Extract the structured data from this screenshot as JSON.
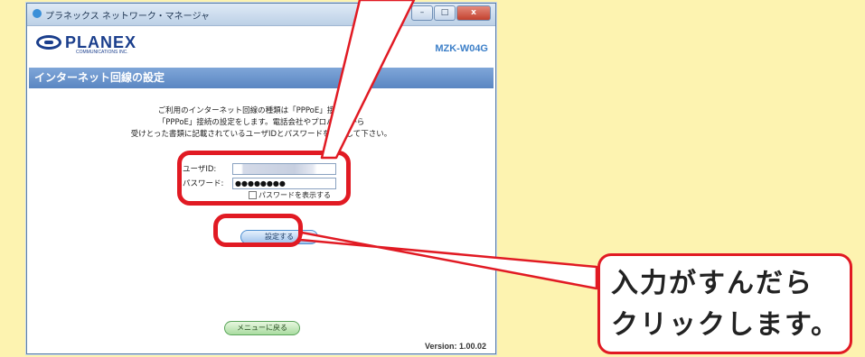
{
  "window": {
    "title": "プラネックス ネットワーク・マネージャ",
    "minimize_glyph": "–",
    "maximize_glyph": "□",
    "close_glyph": "x"
  },
  "brand": {
    "name": "PLANEX",
    "subtitle": "COMMUNICATIONS INC.",
    "model": "MZK-W04G"
  },
  "section": {
    "title": "インターネット回線の設定"
  },
  "intro": {
    "line1": "ご利用のインターネット回線の種類は「PPPoE」接続です。",
    "line2": "「PPPoE」接続の設定をします。電話会社やプロバイダから",
    "line3": "受けとった書類に記載されているユーザIDとパスワードを入力して下さい。"
  },
  "form": {
    "userid_label": "ユーザID:",
    "userid_value": "",
    "password_label": "パスワード:",
    "password_value": "●●●●●●●●",
    "show_password_label": "パスワードを表示する"
  },
  "buttons": {
    "set": "設定する",
    "menu": "メニューに戻る"
  },
  "version": "Version: 1.00.02",
  "callout": {
    "line1": "入力がすんだら",
    "line2": "クリックします。"
  },
  "colors": {
    "background": "#fdf3b0",
    "highlight": "#e11a23",
    "section_bar": "#5a86c2",
    "brand": "#1a3e8c"
  }
}
